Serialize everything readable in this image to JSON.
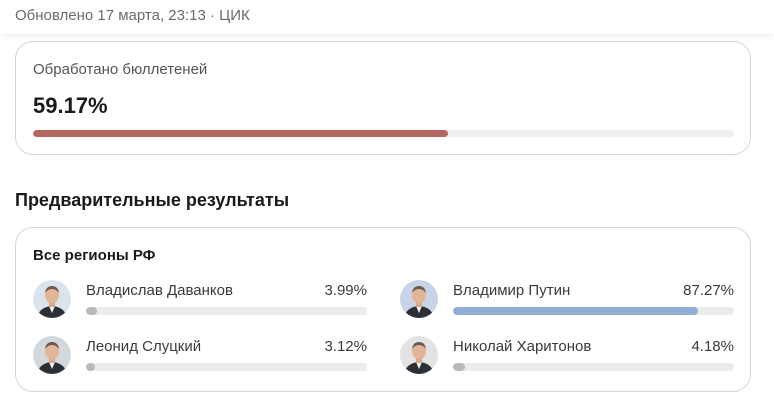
{
  "header": {
    "updated_text": "Обновлено 17 марта, 23:13 · ЦИК"
  },
  "processed": {
    "label": "Обработано бюллетеней",
    "value_text": "59.17%",
    "value": 59.17,
    "color": "#b4675f"
  },
  "section_title": "Предварительные результаты",
  "results": {
    "region": "Все регионы РФ",
    "lead_color": "#8eaed6",
    "other_color": "#b9b9b9",
    "candidates": [
      {
        "name": "Владислав Даванков",
        "pct_text": "3.99%",
        "pct": 3.99,
        "avatar": "portrait-photo",
        "avatar_bg": "#dbe3ec"
      },
      {
        "name": "Владимир Путин",
        "pct_text": "87.27%",
        "pct": 87.27,
        "avatar": "portrait-photo",
        "avatar_bg": "#c7d3e6"
      },
      {
        "name": "Леонид Слуцкий",
        "pct_text": "3.12%",
        "pct": 3.12,
        "avatar": "portrait-photo",
        "avatar_bg": "#d2d8dc"
      },
      {
        "name": "Николай Харитонов",
        "pct_text": "4.18%",
        "pct": 4.18,
        "avatar": "portrait-photo",
        "avatar_bg": "#e3e3e3"
      }
    ]
  }
}
